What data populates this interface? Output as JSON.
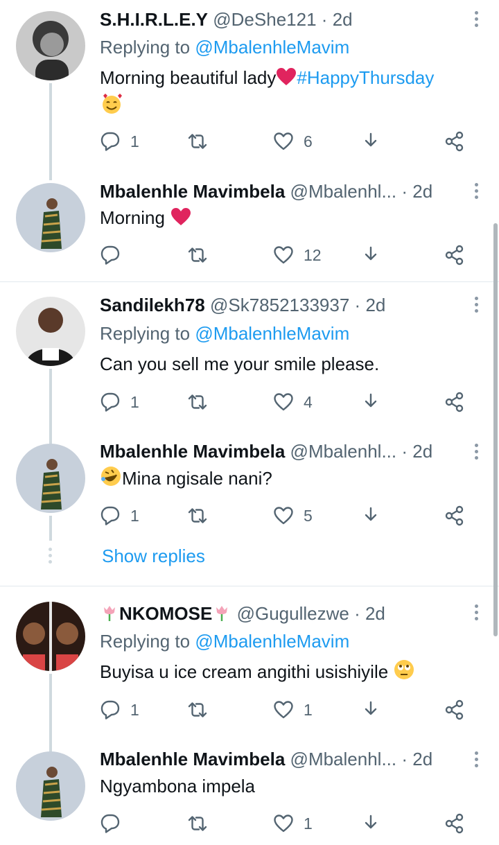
{
  "threads": [
    {
      "author": {
        "name": "S.H.I.R.L.E.Y",
        "handle": "@DeShe121",
        "time": "2d"
      },
      "replying_to": {
        "prefix": "Replying to",
        "mention": "@MbalenhleMavim"
      },
      "text_before": "Morning beautiful lady",
      "hashtag": "#HappyThursday",
      "counts": {
        "replies": "1",
        "likes": "6"
      },
      "reply": {
        "author": {
          "name": "Mbalenhle Mavimbela",
          "handle": "@Mbalenhl...",
          "time": "2d"
        },
        "text": "Morning",
        "counts": {
          "replies": "",
          "likes": "12"
        }
      }
    },
    {
      "author": {
        "name": "Sandilekh78",
        "handle": "@Sk7852133937",
        "time": "2d"
      },
      "replying_to": {
        "prefix": "Replying to",
        "mention": "@MbalenhleMavim"
      },
      "text": "Can you sell me your smile please.",
      "counts": {
        "replies": "1",
        "likes": "4"
      },
      "reply": {
        "author": {
          "name": "Mbalenhle Mavimbela",
          "handle": "@Mbalenhl...",
          "time": "2d"
        },
        "text": "Mina ngisale nani?",
        "counts": {
          "replies": "1",
          "likes": "5"
        }
      },
      "show_replies": "Show replies"
    },
    {
      "author": {
        "name": "NKOMOSE",
        "handle": "@Gugullezwe",
        "time": "2d"
      },
      "replying_to": {
        "prefix": "Replying to",
        "mention": "@MbalenhleMavim"
      },
      "text": "Buyisa u ice cream angithi usishiyile",
      "counts": {
        "replies": "1",
        "likes": "1"
      },
      "reply": {
        "author": {
          "name": "Mbalenhle Mavimbela",
          "handle": "@Mbalenhl...",
          "time": "2d"
        },
        "text": "Ngyambona impela",
        "counts": {
          "replies": "",
          "likes": "1"
        }
      }
    }
  ],
  "separator": "·",
  "icons": [
    "reply-icon",
    "retweet-icon",
    "like-icon",
    "share-icon",
    "more-icon",
    "more-options-icon"
  ],
  "colors": {
    "accent": "#1d9bf0",
    "secondary": "#536471",
    "heart": "#e0245e"
  }
}
